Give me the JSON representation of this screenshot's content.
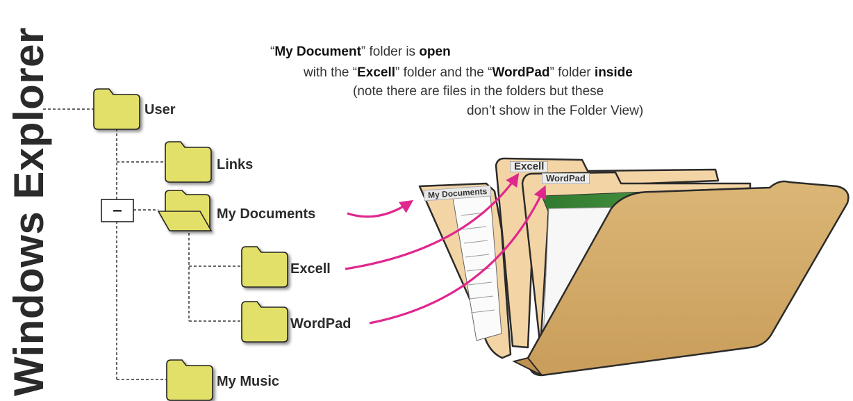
{
  "title": "Windows Explorer",
  "caption": {
    "line1_q1": "“",
    "line1_b1": "My Document",
    "line1_t1": "” folder is ",
    "line1_b2": "open",
    "line2_t1": "with the “",
    "line2_b1": "Excell",
    "line2_t2": "” folder and the “",
    "line2_b2": "WordPad",
    "line2_t3": "” folder ",
    "line2_b3": "inside",
    "line3": "(note there are files in the folders but these",
    "line4": "don’t show in the Folder View)"
  },
  "tree": {
    "user": "User",
    "links": "Links",
    "my_documents": "My Documents",
    "excell": "Excell",
    "wordpad": "WordPad",
    "my_music": "My Music",
    "collapse_symbol": "–"
  },
  "illustration": {
    "tab_my_documents": "My Documents",
    "tab_excell": "Excell",
    "tab_wordpad": "WordPad"
  },
  "colors": {
    "folder_yellow": "#e3e06a",
    "arrow_magenta": "#e0278e",
    "manila": "#f2d2a4",
    "manila_front": "#d7b06e"
  }
}
